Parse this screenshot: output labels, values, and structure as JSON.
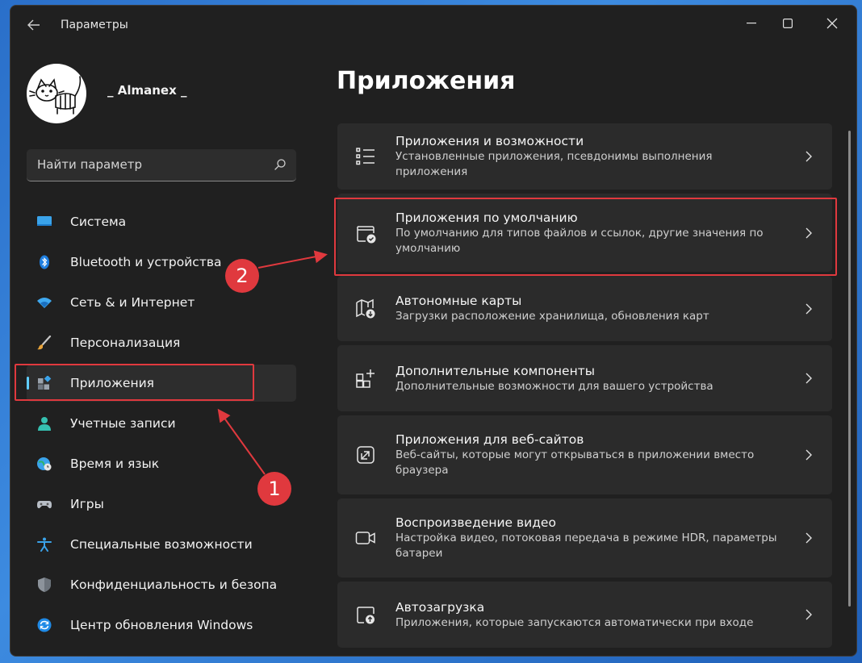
{
  "window": {
    "title": "Параметры"
  },
  "user": {
    "name": "_ Almanex _"
  },
  "search": {
    "placeholder": "Найти параметр"
  },
  "sidebar": {
    "items": [
      {
        "label": "Система",
        "icon": "monitor-icon"
      },
      {
        "label": "Bluetooth и устройства",
        "icon": "bluetooth-icon"
      },
      {
        "label": "Сеть & и Интернет",
        "icon": "wifi-icon"
      },
      {
        "label": "Персонализация",
        "icon": "brush-icon"
      },
      {
        "label": "Приложения",
        "icon": "apps-icon",
        "active": true
      },
      {
        "label": "Учетные записи",
        "icon": "person-icon"
      },
      {
        "label": "Время и язык",
        "icon": "globe-clock-icon"
      },
      {
        "label": "Игры",
        "icon": "gamepad-icon"
      },
      {
        "label": "Специальные возможности",
        "icon": "accessibility-icon"
      },
      {
        "label": "Конфиденциальность и безопас",
        "icon": "shield-icon"
      },
      {
        "label": "Центр обновления Windows",
        "icon": "update-icon"
      }
    ]
  },
  "main": {
    "title": "Приложения",
    "cards": [
      {
        "title": "Приложения и возможности",
        "desc": "Установленные приложения, псевдонимы выполнения приложения",
        "icon": "list-icon"
      },
      {
        "title": "Приложения по умолчанию",
        "desc": "По умолчанию для типов файлов и ссылок, другие значения по умолчанию",
        "icon": "default-apps-icon"
      },
      {
        "title": "Автономные карты",
        "desc": "Загрузки расположение хранилища, обновления карт",
        "icon": "map-download-icon"
      },
      {
        "title": "Дополнительные компоненты",
        "desc": "Дополнительные возможности для вашего устройства",
        "icon": "optional-features-icon"
      },
      {
        "title": "Приложения для веб-сайтов",
        "desc": "Веб-сайты, которые могут открываться в приложении вместо браузера",
        "icon": "web-open-icon"
      },
      {
        "title": "Воспроизведение видео",
        "desc": "Настройка видео, потоковая передача в режиме HDR, параметры батареи",
        "icon": "video-icon"
      },
      {
        "title": "Автозагрузка",
        "desc": "Приложения, которые запускаются автоматически при входе",
        "icon": "startup-icon"
      }
    ]
  },
  "annotations": {
    "badge1": "1",
    "badge2": "2",
    "color": "#e0393e"
  },
  "colors": {
    "accent": "#60cdff",
    "window_bg": "#202020",
    "card_bg": "#2b2b2b"
  }
}
